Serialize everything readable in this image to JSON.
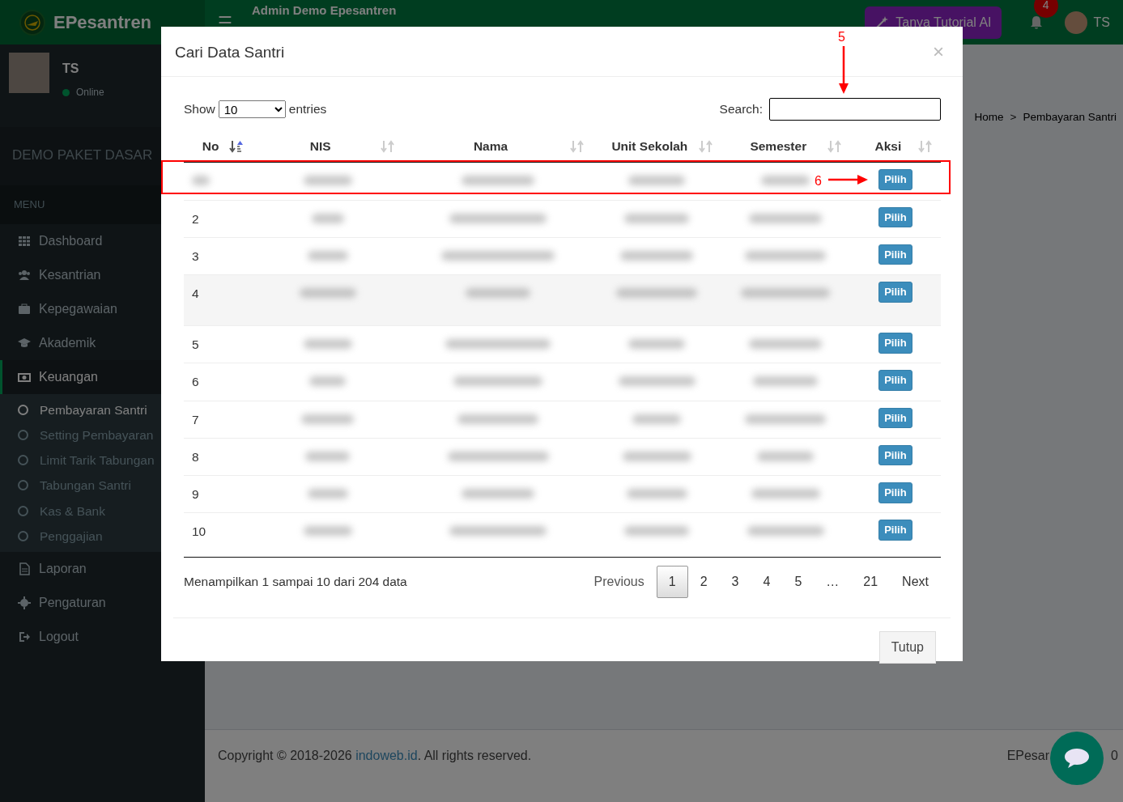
{
  "app": {
    "brand": "EPesantren",
    "title": "Admin Demo Epesantren",
    "ai_button": "Tanya Tutorial AI",
    "notification_count": "4",
    "user_initials": "TS",
    "menu_toggle": "☰"
  },
  "sidebar": {
    "user_name": "TS",
    "user_status": "Online",
    "package": "DEMO PAKET DASAR",
    "menu_header": "MENU",
    "items": [
      {
        "label": "Dashboard",
        "expanded": false
      },
      {
        "label": "Kesantrian",
        "expanded": false
      },
      {
        "label": "Kepegawaian",
        "expanded": false
      },
      {
        "label": "Akademik",
        "expanded": false
      },
      {
        "label": "Keuangan",
        "expanded": true,
        "children": [
          {
            "label": "Pembayaran Santri",
            "selected": true
          },
          {
            "label": "Setting Pembayaran",
            "selected": false
          },
          {
            "label": "Limit Tarik Tabungan",
            "selected": false
          },
          {
            "label": "Tabungan Santri",
            "selected": false
          },
          {
            "label": "Kas & Bank",
            "selected": false
          },
          {
            "label": "Penggajian",
            "selected": false
          }
        ]
      },
      {
        "label": "Laporan",
        "expanded": false
      },
      {
        "label": "Pengaturan",
        "expanded": false
      },
      {
        "label": "Logout",
        "expanded": false
      }
    ]
  },
  "breadcrumb": [
    {
      "label": "Home"
    },
    {
      "label": "Pembayaran Santri"
    }
  ],
  "breadcrumb_separator": ">",
  "footer": {
    "copyright_before": "Copyright © 2018-2026 ",
    "copyright_link": "indoweb.id",
    "copyright_after": ". All rights reserved.",
    "right_start": "EPesar",
    "right_end": "0"
  },
  "modal": {
    "title": "Cari Data Santri",
    "close": "×",
    "show_label": "Show",
    "page_size": "10",
    "entries_label": "entries",
    "search_label": "Search:",
    "columns": [
      {
        "label": "No",
        "sorted": true
      },
      {
        "label": "NIS",
        "sorted": false
      },
      {
        "label": "Nama",
        "sorted": false
      },
      {
        "label": "Unit Sekolah",
        "sorted": false
      },
      {
        "label": "Semester",
        "sorted": false
      },
      {
        "label": "Aksi",
        "sorted": false
      }
    ],
    "rows": [
      {
        "kind": "blurred",
        "action": "Pilih",
        "hovered": false
      },
      {
        "kind": "numbered",
        "no": "2",
        "action": "Pilih",
        "hovered": false
      },
      {
        "kind": "numbered",
        "no": "3",
        "action": "Pilih",
        "hovered": false
      },
      {
        "kind": "numbered",
        "no": "4",
        "action": "Pilih",
        "hovered": true
      },
      {
        "kind": "numbered",
        "no": "5",
        "action": "Pilih",
        "hovered": false
      },
      {
        "kind": "numbered",
        "no": "6",
        "action": "Pilih",
        "hovered": false
      },
      {
        "kind": "numbered",
        "no": "7",
        "action": "Pilih",
        "hovered": false
      },
      {
        "kind": "numbered",
        "no": "8",
        "action": "Pilih",
        "hovered": false
      },
      {
        "kind": "numbered",
        "no": "9",
        "action": "Pilih",
        "hovered": false
      },
      {
        "kind": "numbered",
        "no": "10",
        "action": "Pilih",
        "hovered": false
      }
    ],
    "info": "Menampilkan 1 sampai 10 dari 204 data",
    "pagination": {
      "previous": "Previous",
      "pages": [
        {
          "label": "1",
          "selected": true
        },
        {
          "label": "2",
          "selected": false
        },
        {
          "label": "3",
          "selected": false
        },
        {
          "label": "4",
          "selected": false
        },
        {
          "label": "5",
          "selected": false
        }
      ],
      "ellipsis": "…",
      "last_pages": [
        {
          "label": "21",
          "selected": false
        }
      ],
      "next": "Next"
    },
    "close_button": "Tutup"
  },
  "annotations": [
    {
      "label": "5",
      "kind": "vertical"
    },
    {
      "label": "6",
      "kind": "horizontal"
    }
  ]
}
